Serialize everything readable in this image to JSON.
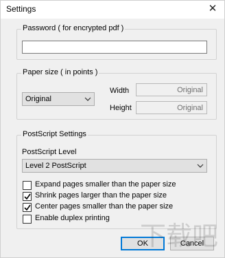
{
  "window": {
    "title": "Settings",
    "close_glyph": "✕"
  },
  "password_group": {
    "legend": "Password ( for encrypted pdf )",
    "value": ""
  },
  "paper_group": {
    "legend": "Paper size ( in points )",
    "size_select": "Original",
    "width_label": "Width",
    "width_value": "Original",
    "height_label": "Height",
    "height_value": "Original"
  },
  "postscript_group": {
    "legend": "PostScript Settings",
    "level_label": "PostScript Level",
    "level_select": "Level 2 PostScript",
    "options": [
      {
        "label": "Expand pages smaller than the paper size",
        "checked": false
      },
      {
        "label": "Shrink pages larger than the paper size",
        "checked": true
      },
      {
        "label": "Center pages smaller than the paper size",
        "checked": true
      },
      {
        "label": "Enable duplex printing",
        "checked": false
      }
    ]
  },
  "buttons": {
    "ok": "OK",
    "cancel": "Cancel"
  },
  "watermark": {
    "text": "下载吧"
  }
}
